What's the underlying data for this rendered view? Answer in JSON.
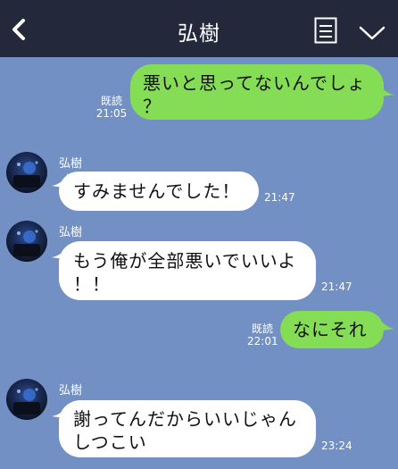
{
  "header": {
    "title": "弘樹"
  },
  "messages": [
    {
      "side": "right",
      "text": "悪いと思ってないんでしょ\n？",
      "read": "既読",
      "time": "21:05"
    },
    {
      "side": "left",
      "sender": "弘樹",
      "text": "すみませんでした！",
      "time": "21:47"
    },
    {
      "side": "left",
      "sender": "弘樹",
      "text": "もう俺が全部悪いでいいよ\n！！",
      "time": "21:47"
    },
    {
      "side": "right",
      "text": "なにそれ",
      "read": "既読",
      "time": "22:01"
    },
    {
      "side": "left",
      "sender": "弘樹",
      "text": "謝ってんだからいいじゃん\nしつこい",
      "time": "23:24"
    }
  ],
  "colors": {
    "background": "#7290c3",
    "header": "#23283a",
    "sent_bubble": "#84dd55",
    "received_bubble": "#ffffff"
  },
  "icons": [
    "back-chevron-icon",
    "notes-icon",
    "chevron-down-icon"
  ]
}
